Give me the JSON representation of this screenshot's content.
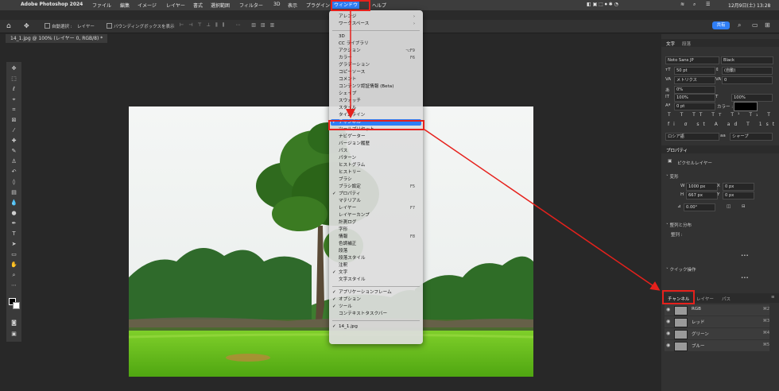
{
  "menubar": {
    "app_name": "Adobe Photoshop 2024",
    "items": [
      "ファイル",
      "編集",
      "イメージ",
      "レイヤー",
      "書式",
      "選択範囲",
      "フィルター",
      "3D",
      "表示",
      "プラグイン",
      "ウィンドウ",
      "ヘルプ"
    ],
    "datetime": "12月9日(土) 13:28"
  },
  "optionsbar": {
    "auto_select_label": "自動選択 :",
    "layer_select": "レイヤー",
    "bounding_box_label": "バウンディングボックスを表示",
    "share_button": "共有"
  },
  "document": {
    "tab_title": "14_1.jpg @ 100% (レイヤー 0, RGB/8) *"
  },
  "window_menu": {
    "items": [
      {
        "label": "アレンジ",
        "submenu": true
      },
      {
        "label": "ワークスペース",
        "submenu": true
      },
      {
        "separator": true
      },
      {
        "label": "3D"
      },
      {
        "label": "CC ライブラリ"
      },
      {
        "label": "アクション",
        "shortcut": "⌥F9"
      },
      {
        "label": "カラー",
        "shortcut": "F6"
      },
      {
        "label": "グラデーション"
      },
      {
        "label": "コピーソース"
      },
      {
        "label": "コメント"
      },
      {
        "label": "コンテンツ認証情報 (Beta)"
      },
      {
        "label": "シェイプ"
      },
      {
        "label": "スウォッチ"
      },
      {
        "label": "スタイル"
      },
      {
        "label": "タイムライン"
      },
      {
        "label": "チャンネル",
        "checked": true,
        "highlighted": true
      },
      {
        "label": "ツールプリセット"
      },
      {
        "label": "ナビゲーター"
      },
      {
        "label": "バージョン履歴"
      },
      {
        "label": "パス"
      },
      {
        "label": "パターン"
      },
      {
        "label": "ヒストグラム"
      },
      {
        "label": "ヒストリー"
      },
      {
        "label": "ブラシ"
      },
      {
        "label": "ブラシ設定",
        "shortcut": "F5"
      },
      {
        "label": "プロパティ",
        "checked": true
      },
      {
        "label": "マテリアル"
      },
      {
        "label": "レイヤー",
        "shortcut": "F7"
      },
      {
        "label": "レイヤーカンプ"
      },
      {
        "label": "計測ログ"
      },
      {
        "label": "字形"
      },
      {
        "label": "情報",
        "shortcut": "F8"
      },
      {
        "label": "色調補正"
      },
      {
        "label": "段落"
      },
      {
        "label": "段落スタイル"
      },
      {
        "label": "注釈"
      },
      {
        "label": "文字",
        "checked": true
      },
      {
        "label": "文字スタイル"
      },
      {
        "separator": true
      },
      {
        "label": "アプリケーションフレーム",
        "checked": true
      },
      {
        "label": "オプション",
        "checked": true
      },
      {
        "label": "ツール",
        "checked": true
      },
      {
        "label": "コンテキストタスクバー"
      },
      {
        "separator": true
      },
      {
        "label": "14_1.jpg",
        "checked": true
      }
    ]
  },
  "right_panel": {
    "char_tabs": [
      "文字",
      "段落"
    ],
    "font_family": "Noto Sans JP",
    "font_style": "Black",
    "font_size": "50 pt",
    "leading": "(自動)",
    "kerning": "メトリクス",
    "tracking": "0",
    "tsume": "0%",
    "vscale": "100%",
    "hscale": "100%",
    "baseline": "0 pt",
    "color_label": "カラー :",
    "language": "ロシア語",
    "antialias": "シャープ",
    "properties_tab": "プロパティ",
    "properties_type": "ピクセルレイヤー",
    "transform_label": "変形",
    "w_label": "W",
    "w_value": "1000 px",
    "x_label": "X",
    "x_value": "0 px",
    "h_label": "H",
    "h_value": "667 px",
    "y_label": "Y",
    "y_value": "0 px",
    "angle_value": "0.00°",
    "align_label": "整列と分布",
    "align_sub": "整列 :",
    "quick_label": "クイック操作",
    "bottom_tabs": [
      "チャンネル",
      "レイヤー",
      "パス"
    ],
    "channels": [
      {
        "name": "RGB",
        "shortcut": "⌘2"
      },
      {
        "name": "レッド",
        "shortcut": "⌘3"
      },
      {
        "name": "グリーン",
        "shortcut": "⌘4"
      },
      {
        "name": "ブルー",
        "shortcut": "⌘5"
      }
    ]
  },
  "colors": {
    "highlight": "#2f7ef5",
    "annotation_red": "#e6211c",
    "menubar_bg": "#3d3d3d"
  }
}
